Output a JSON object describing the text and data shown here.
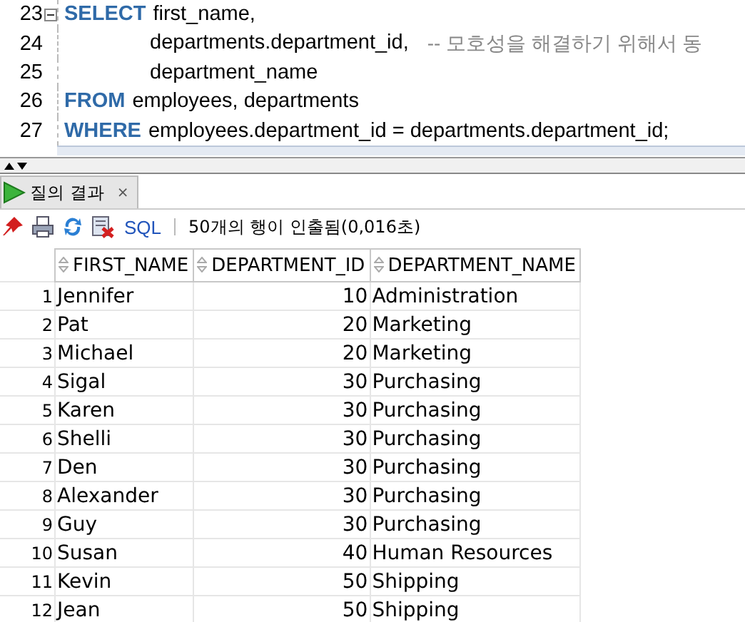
{
  "editor": {
    "lines": [
      {
        "number": "23",
        "fold": true,
        "indent": false,
        "tokens": [
          {
            "kind": "keyword",
            "text": "SELECT"
          },
          {
            "kind": "text",
            "text": "first_name,"
          }
        ]
      },
      {
        "number": "24",
        "fold": false,
        "indent": true,
        "tokens": [
          {
            "kind": "text",
            "text": "departments.department_id,"
          },
          {
            "kind": "comment",
            "text": "-- 모호성을 해결하기 위해서 동"
          }
        ]
      },
      {
        "number": "25",
        "fold": false,
        "indent": true,
        "tokens": [
          {
            "kind": "text",
            "text": "department_name"
          }
        ]
      },
      {
        "number": "26",
        "fold": false,
        "indent": false,
        "tokens": [
          {
            "kind": "keyword",
            "text": "FROM"
          },
          {
            "kind": "text",
            "text": "employees, departments"
          }
        ]
      },
      {
        "number": "27",
        "fold": false,
        "indent": false,
        "tokens": [
          {
            "kind": "keyword",
            "text": "WHERE"
          },
          {
            "kind": "text",
            "text": "employees.department_id = departments.department_id;"
          }
        ]
      }
    ]
  },
  "tabs": [
    {
      "label": "질의 결과",
      "close": "×",
      "selected": true
    }
  ],
  "toolbar": {
    "sql_link": "SQL",
    "status": "50개의 행이 인출됨(0,016초)"
  },
  "table": {
    "columns": [
      "",
      "FIRST_NAME",
      "DEPARTMENT_ID",
      "DEPARTMENT_NAME"
    ],
    "rows": [
      [
        "1",
        "Jennifer",
        "10",
        "Administration"
      ],
      [
        "2",
        "Pat",
        "20",
        "Marketing"
      ],
      [
        "3",
        "Michael",
        "20",
        "Marketing"
      ],
      [
        "4",
        "Sigal",
        "30",
        "Purchasing"
      ],
      [
        "5",
        "Karen",
        "30",
        "Purchasing"
      ],
      [
        "6",
        "Shelli",
        "30",
        "Purchasing"
      ],
      [
        "7",
        "Den",
        "30",
        "Purchasing"
      ],
      [
        "8",
        "Alexander",
        "30",
        "Purchasing"
      ],
      [
        "9",
        "Guy",
        "30",
        "Purchasing"
      ],
      [
        "10",
        "Susan",
        "40",
        "Human Resources"
      ],
      [
        "11",
        "Kevin",
        "50",
        "Shipping"
      ],
      [
        "12",
        "Jean",
        "50",
        "Shipping"
      ]
    ]
  }
}
